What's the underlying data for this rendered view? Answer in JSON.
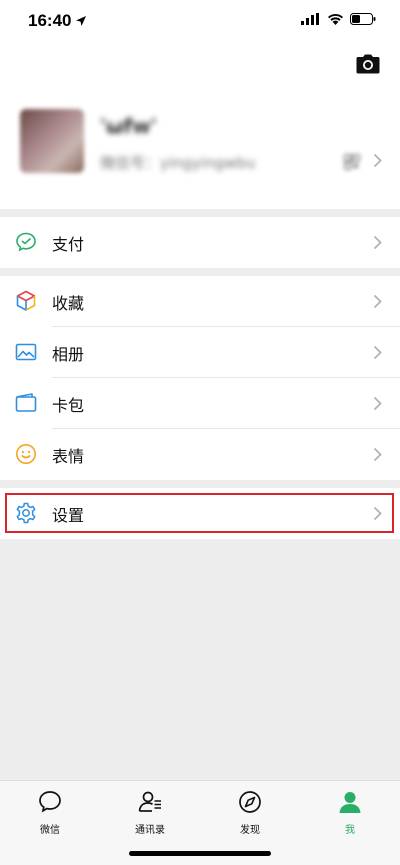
{
  "status_bar": {
    "time": "16:40"
  },
  "profile": {
    "nickname": "'ωfw'",
    "wechat_id": "微信号：yingyingwbu"
  },
  "menu": {
    "pay": {
      "label": "支付"
    },
    "favorites": {
      "label": "收藏"
    },
    "album": {
      "label": "相册"
    },
    "cards": {
      "label": "卡包"
    },
    "stickers": {
      "label": "表情"
    },
    "settings": {
      "label": "设置"
    }
  },
  "tabs": [
    {
      "label": "微信",
      "icon": "chat-bubble-icon",
      "active": false
    },
    {
      "label": "通讯录",
      "icon": "contacts-icon",
      "active": false
    },
    {
      "label": "发现",
      "icon": "compass-icon",
      "active": false
    },
    {
      "label": "我",
      "icon": "person-icon",
      "active": true
    }
  ],
  "colors": {
    "accent": "#2aae67",
    "highlight_border": "#d9242a",
    "background": "#ededed"
  }
}
